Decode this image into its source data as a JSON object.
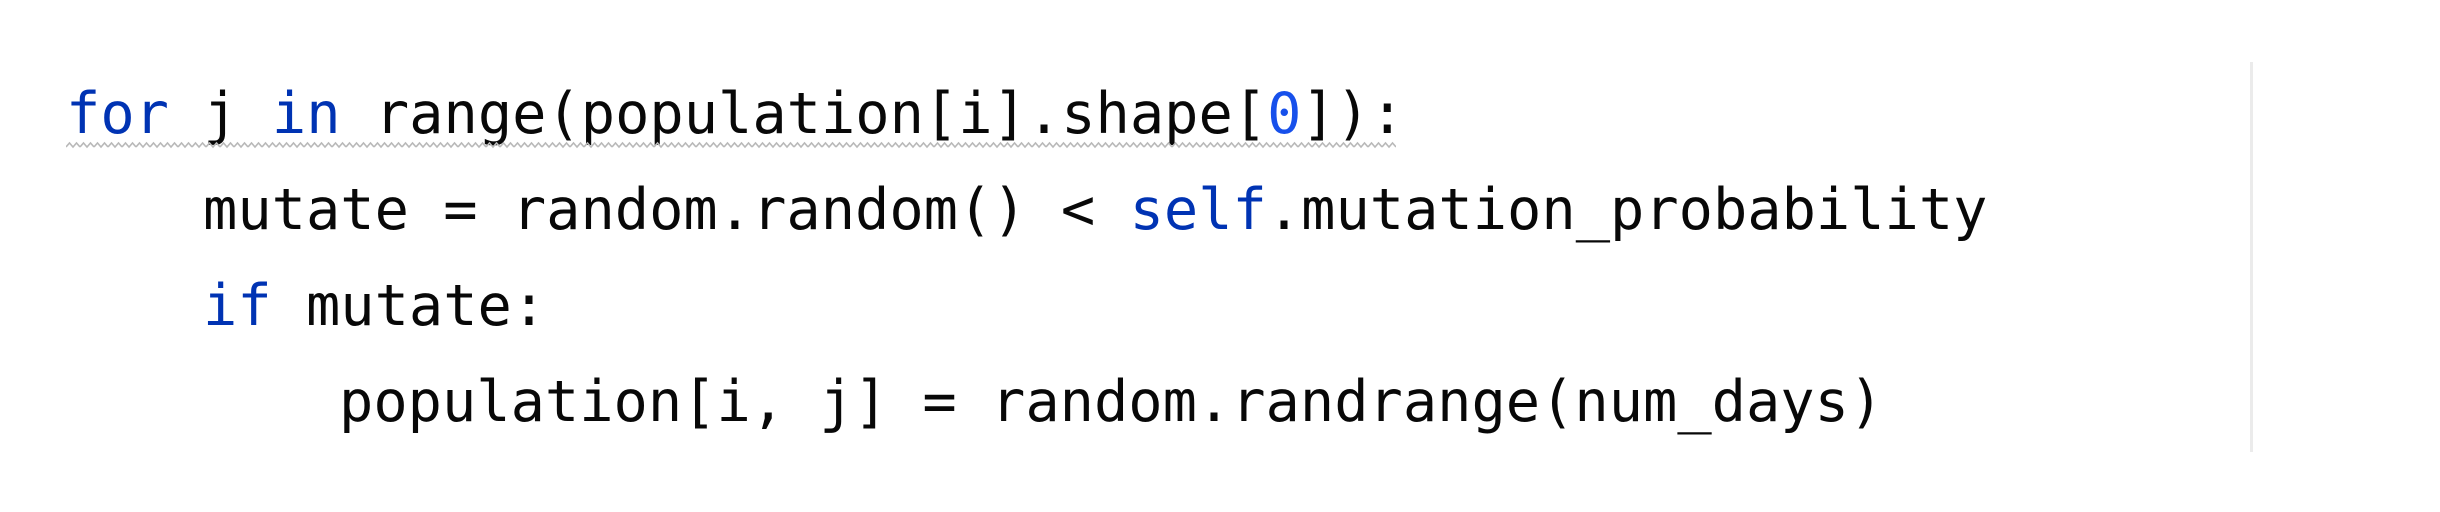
{
  "editor": {
    "lines": [
      {
        "tokens": [
          {
            "text": "for",
            "kind": "keyword"
          },
          {
            "text": " j ",
            "kind": "plain"
          },
          {
            "text": "in",
            "kind": "keyword"
          },
          {
            "text": " range(population[i].shape[",
            "kind": "plain"
          },
          {
            "text": "0",
            "kind": "number"
          },
          {
            "text": "]):",
            "kind": "plain"
          }
        ]
      },
      {
        "tokens": [
          {
            "text": "mutate = random.random() < ",
            "kind": "plain"
          },
          {
            "text": "self",
            "kind": "keyword"
          },
          {
            "text": ".mutation_probability",
            "kind": "plain"
          }
        ]
      },
      {
        "tokens": [
          {
            "text": "if",
            "kind": "keyword"
          },
          {
            "text": " mutate:",
            "kind": "plain"
          }
        ]
      },
      {
        "tokens": [
          {
            "text": "population[i, j] = random.randrange(num_days)",
            "kind": "plain"
          }
        ]
      }
    ]
  },
  "colors": {
    "background": "#ffffff",
    "keyword": "#0033b3",
    "number": "#1750eb",
    "plain": "#080808",
    "squiggle": "#b9b9b9",
    "right_margin_guide": "#ebebeb"
  }
}
